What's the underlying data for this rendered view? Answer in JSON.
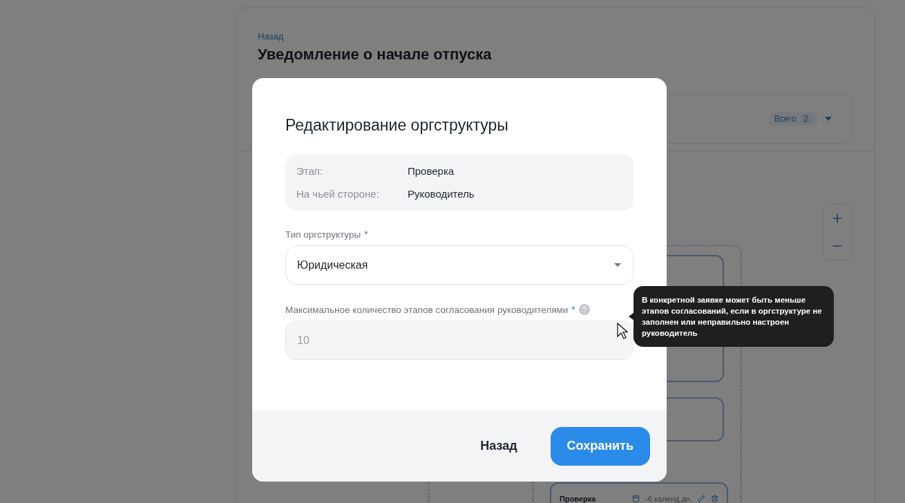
{
  "page": {
    "back_link": "Назад",
    "title": "Уведомление о начале отпуска",
    "total_label": "Всего",
    "total_count": "2",
    "nodes": [
      {
        "title": "Проверка",
        "duration": "-6 календ.дн."
      }
    ]
  },
  "dialog": {
    "title": "Редактирование оргструктуры",
    "info": [
      {
        "label": "Этап:",
        "value": "Проверка"
      },
      {
        "label": "На чьей стороне:",
        "value": "Руководитель"
      }
    ],
    "fields": [
      {
        "kind": "select",
        "label": "Тип оргструктуры",
        "required_mark": "*",
        "value": "Юридическая",
        "disabled": false
      },
      {
        "kind": "number",
        "label": "Максимальное количество этапов согласования руководителями",
        "required_mark": "*",
        "help": "?",
        "value": "10",
        "disabled": true
      }
    ],
    "tooltip": "В конкретной заявке может быть меньше этапов согласований, если в оргструктуре не заполнен или неправильно настроен руководитель",
    "buttons": [
      {
        "label": "Назад",
        "kind": "secondary"
      },
      {
        "label": "Сохранить",
        "kind": "primary"
      }
    ]
  }
}
